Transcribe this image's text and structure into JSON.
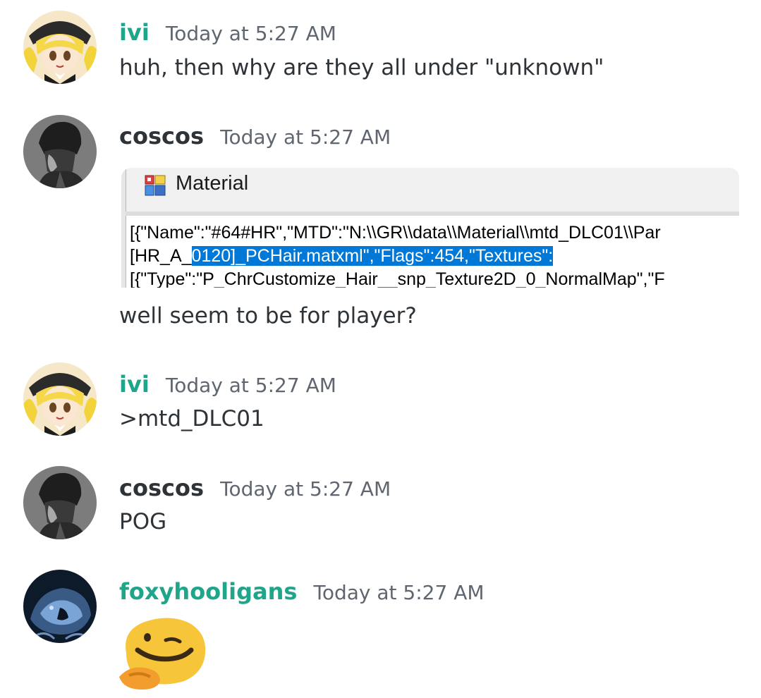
{
  "messages": [
    {
      "username": "ivi",
      "user_color": "#1fa58a",
      "timestamp": "Today at 5:27 AM",
      "text": "huh, then why are they all under \"unknown\"",
      "avatar": "anime-girl-avatar"
    },
    {
      "username": "coscos",
      "user_color": "#2e3338",
      "timestamp": "Today at 5:27 AM",
      "text": "well seem to be for player?",
      "avatar": "dark-hooded-figure-avatar",
      "attachment": {
        "title": "Material",
        "lines": [
          {
            "pre": "[{\"Name\":\"#64#HR\",\"MTD\":\"N:\\\\GR\\\\data\\\\Material\\\\mtd_DLC01\\\\Par",
            "selected": "",
            "post": ""
          },
          {
            "pre": "[HR_A_",
            "selected": "0120]_PCHair.matxml\",\"Flags\":454,\"Textures\":",
            "post": ""
          },
          {
            "pre": "[{\"Type\":\"P_ChrCustomize_Hair__snp_Texture2D_0_NormalMap\",\"F",
            "selected": "",
            "post": ""
          }
        ]
      }
    },
    {
      "username": "ivi",
      "user_color": "#1fa58a",
      "timestamp": "Today at 5:27 AM",
      "text": ">mtd_DLC01",
      "avatar": "anime-girl-avatar"
    },
    {
      "username": "coscos",
      "user_color": "#2e3338",
      "timestamp": "Today at 5:27 AM",
      "text": "POG",
      "avatar": "dark-hooded-figure-avatar"
    },
    {
      "username": "foxyhooligans",
      "user_color": "#1fa58a",
      "timestamp": "Today at 5:27 AM",
      "text": "",
      "avatar": "blue-creature-avatar",
      "emoji": "thinking-smirk-emoji"
    }
  ],
  "colors": {
    "selection": "#0078d7",
    "timestamp": "#5f6670",
    "emoji_yellow": "#f7c53a",
    "emoji_orange": "#f29d2e"
  }
}
